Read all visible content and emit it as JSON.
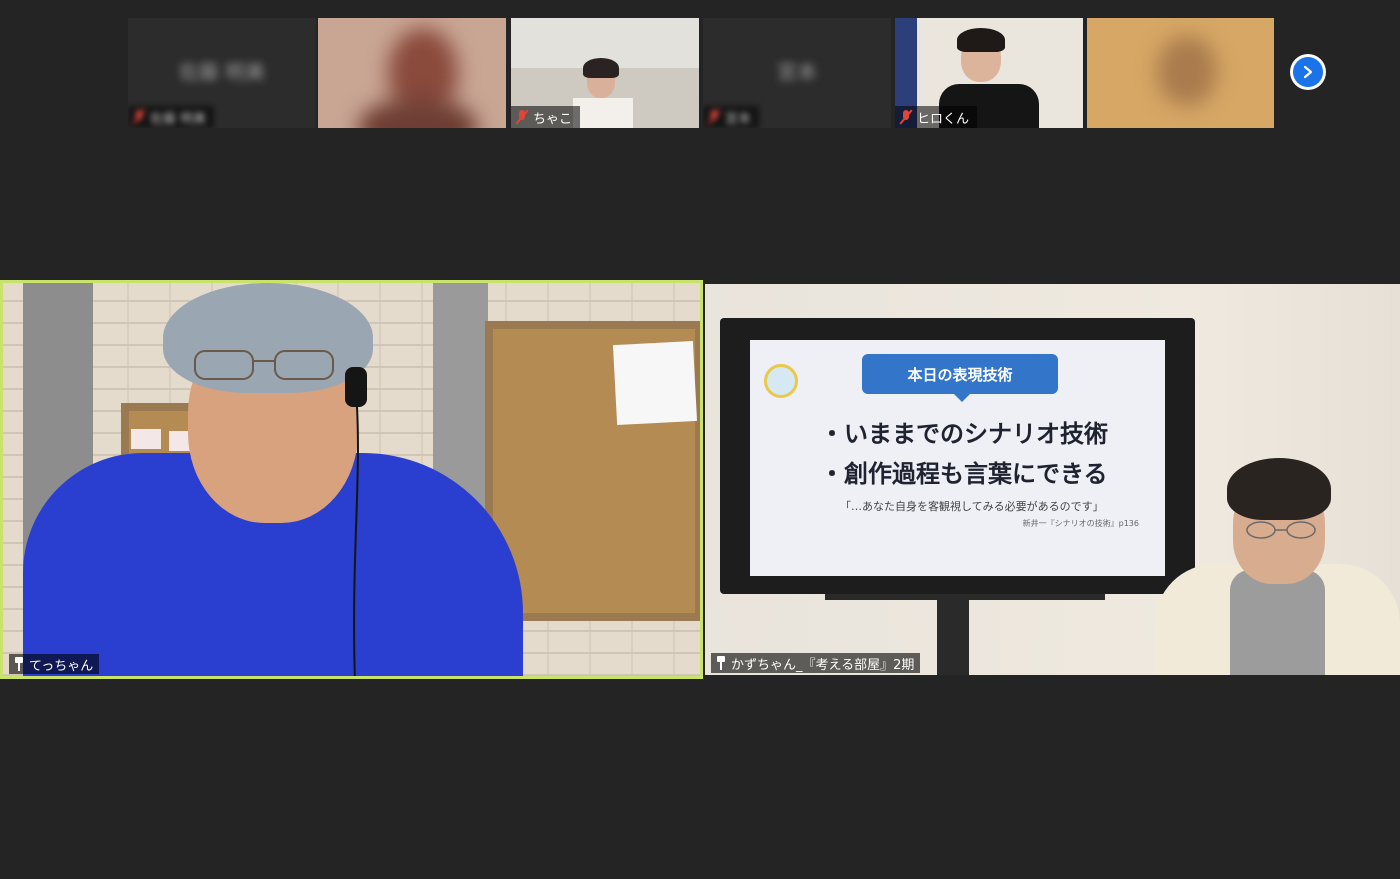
{
  "gallery": {
    "participants": [
      {
        "name": "",
        "muted": true,
        "blurred": true,
        "placeholder_text": "佐藤 明美",
        "tone": "#2c2c2c"
      },
      {
        "name": "",
        "muted": false,
        "blurred": true,
        "placeholder_text": "",
        "tone": "#c99a8a"
      },
      {
        "name": "ちゃこ",
        "muted": true,
        "blurred": false,
        "placeholder_text": "",
        "tone": "#c9c4b8"
      },
      {
        "name": "",
        "muted": true,
        "blurred": true,
        "placeholder_text": "宮本",
        "tone": "#2c2c2c"
      },
      {
        "name": "ヒロくん",
        "muted": true,
        "blurred": false,
        "placeholder_text": "",
        "tone": "#e8e3da"
      },
      {
        "name": "",
        "muted": false,
        "blurred": true,
        "placeholder_text": "",
        "tone": "#d2a060"
      }
    ],
    "next_icon": "chevron-right-icon",
    "accent_color": "#1a73e8"
  },
  "main": {
    "left": {
      "name": "てっちゃん",
      "pinned": true,
      "active_speaker_border": "#c9e26a"
    },
    "right": {
      "name": "かずちゃん_『考える部屋』2期",
      "pinned": true,
      "slide": {
        "title": "本日の表現技術",
        "line1": "・いままでのシナリオ技術",
        "line2": "・創作過程も言葉にできる",
        "quote": "「…あなた自身を客観視してみる必要があるのです」",
        "ref": "新井一『シナリオの技術』p136"
      }
    }
  }
}
